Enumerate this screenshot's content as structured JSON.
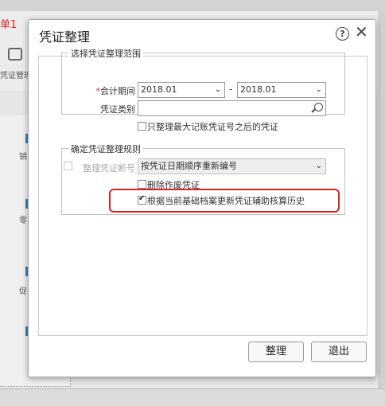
{
  "background": {
    "red_text": "单1",
    "toolbar_caption": "凭证管理",
    "side_items": [
      "销",
      "零",
      "促"
    ]
  },
  "dialog": {
    "title": "凭证整理",
    "help_icon": "help-icon",
    "close_icon": "close-icon",
    "scope_group": {
      "legend": "选择凭证整理范围",
      "period_label": "会计期间",
      "period_required_mark": "*",
      "period_from": "2018.01",
      "period_separator": "-",
      "period_to": "2018.01",
      "voucher_type_label": "凭证类别",
      "voucher_type_value": "",
      "only_after_max_label": "只整理最大记账凭证号之后的凭证",
      "only_after_max_checked": false
    },
    "rule_group": {
      "legend": "确定凭证整理规则",
      "renumber_label": "整理凭证断号",
      "renumber_checked": false,
      "renumber_option": "按凭证日期顺序重新编号",
      "delete_void_label": "删除作废凭证",
      "delete_void_checked": false,
      "update_history_label": "根据当前基础档案更新凭证辅助核算历史",
      "update_history_checked": true
    },
    "buttons": {
      "organize": "整理",
      "exit": "退出"
    },
    "highlight_color": "#d9251d"
  }
}
